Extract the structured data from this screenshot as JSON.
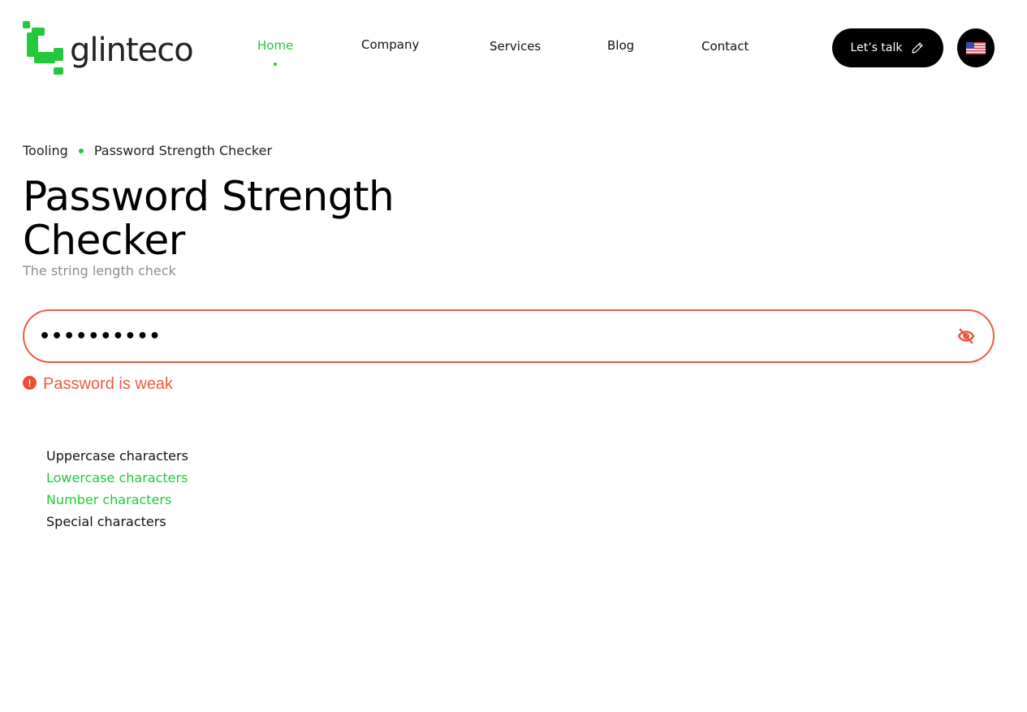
{
  "brand": {
    "name": "glinteco",
    "accent_color": "#22c93d",
    "error_color": "#ef5a45"
  },
  "nav": {
    "items": [
      {
        "label": "Home",
        "active": true
      },
      {
        "label": "Company",
        "active": false
      },
      {
        "label": "Services",
        "active": false
      },
      {
        "label": "Blog",
        "active": false
      },
      {
        "label": "Contact",
        "active": false
      }
    ],
    "cta_label": "Let’s talk",
    "cta_icon": "pencil-icon",
    "language_icon": "us-flag-icon"
  },
  "breadcrumb": {
    "items": [
      "Tooling",
      "Password Strength Checker"
    ]
  },
  "page": {
    "title": "Password Strength Checker",
    "subtitle": "The string length check"
  },
  "password": {
    "value": "••••••••••",
    "visibility_icon": "eye-off-icon",
    "status_icon": "alert-circle-icon",
    "status_text": "Password is weak"
  },
  "rules": [
    {
      "label": "Uppercase characters",
      "satisfied": false
    },
    {
      "label": "Lowercase characters",
      "satisfied": true
    },
    {
      "label": "Number characters",
      "satisfied": true
    },
    {
      "label": "Special characters",
      "satisfied": false
    }
  ]
}
